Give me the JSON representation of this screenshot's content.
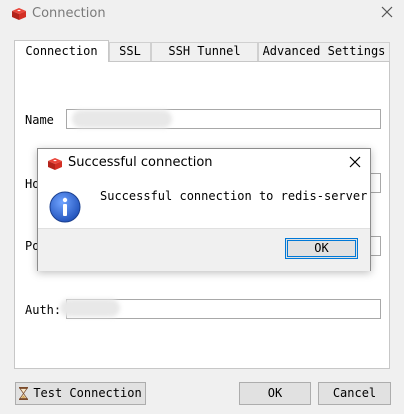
{
  "window": {
    "title": "Connection",
    "title_icon": "redis-logo-icon",
    "close_icon": "close-icon"
  },
  "tabs": [
    {
      "label": "Connection",
      "active": true
    },
    {
      "label": "SSL",
      "active": false
    },
    {
      "label": "SSH Tunnel",
      "active": false
    },
    {
      "label": "Advanced Settings",
      "active": false
    }
  ],
  "form": {
    "name_label": "Name",
    "host_label": "Ho",
    "port_label": "Po",
    "auth_label": "Auth:"
  },
  "footer": {
    "test_connection_label": "Test Connection",
    "test_connection_icon": "hourglass-icon",
    "ok_label": "OK",
    "cancel_label": "Cancel"
  },
  "dialog": {
    "title": "Successful connection",
    "title_icon": "redis-logo-icon",
    "message": "Successful connection to redis-server",
    "ok_label": "OK",
    "info_icon": "info-icon"
  },
  "colors": {
    "accent": "#0078d7",
    "info_blue": "#1e5bc6",
    "redis_red": "#d82c20"
  }
}
